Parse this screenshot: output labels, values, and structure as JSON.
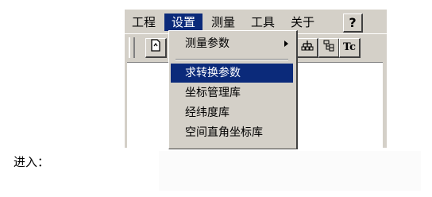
{
  "menubar": {
    "items": [
      "工程",
      "设置",
      "测量",
      "工具",
      "关于"
    ],
    "active_index": 1,
    "help_label": "?"
  },
  "toolbar": {
    "buttons": [
      {
        "name": "file-icon",
        "glyph": "🗋"
      },
      {
        "name": "tree-icon",
        "glyph": "⛫"
      },
      {
        "name": "hierarchy-icon",
        "glyph": "⚲"
      },
      {
        "name": "transform-tc-icon",
        "glyph": "Tc"
      }
    ]
  },
  "dropdown": {
    "items": [
      {
        "label": "测量参数",
        "submenu": true
      },
      {
        "label": "求转换参数",
        "highlighted": true
      },
      {
        "label": "坐标管理库"
      },
      {
        "label": "经纬度库"
      },
      {
        "label": "空间直角坐标库"
      }
    ]
  },
  "caption": "进入：",
  "colors": {
    "highlight": "#0b2a7a",
    "face": "#d4d0c8"
  }
}
